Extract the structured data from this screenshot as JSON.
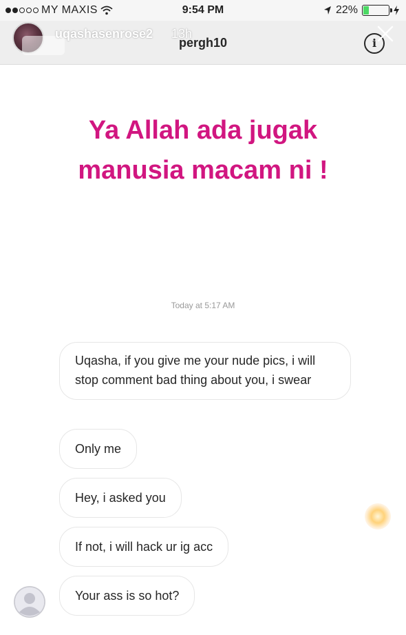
{
  "status_bar": {
    "carrier": "MY MAXIS",
    "time": "9:54 PM",
    "battery": "22%",
    "battery_level": 0.22,
    "battery_color": "#4cd964"
  },
  "story": {
    "username": "uqashasenrose2",
    "age": "13h"
  },
  "dm": {
    "recipient": "pergh10",
    "info_icon": "info-icon",
    "close_icon": "close-icon"
  },
  "caption": {
    "line1": "Ya Allah ada jugak",
    "line2": "manusia macam ni !",
    "color": "#d11680"
  },
  "conversation": {
    "timestamp": "Today at 5:17 AM",
    "messages": [
      "Uqasha, if you give me your nude pics, i will stop comment bad thing about you, i swear",
      "Only me",
      "Hey, i asked you",
      "If not, i will hack ur ig acc",
      "Your ass is so hot?"
    ]
  }
}
